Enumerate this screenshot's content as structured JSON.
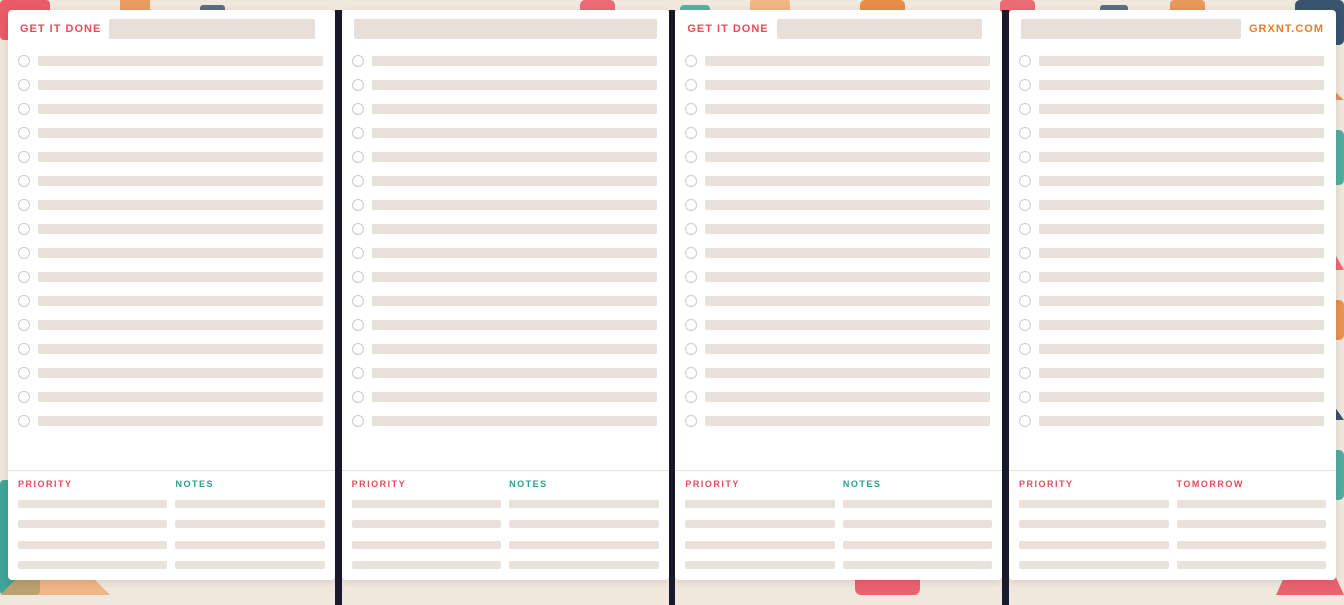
{
  "cards": [
    {
      "id": "card1",
      "brand_left": "GET IT DONE",
      "brand_right": "",
      "show_right": false,
      "bottom_sections": [
        {
          "label": "PRIORITY",
          "label_class": "priority"
        },
        {
          "label": "NOTES",
          "label_class": "notes"
        }
      ],
      "checklist_rows": 16
    },
    {
      "id": "card2",
      "brand_left": "",
      "brand_right": "",
      "show_right": false,
      "bottom_sections": [
        {
          "label": "PRIORITY",
          "label_class": "priority"
        },
        {
          "label": "NOTES",
          "label_class": "notes"
        }
      ],
      "checklist_rows": 16
    },
    {
      "id": "card3",
      "brand_left": "GET IT DONE",
      "brand_right": "",
      "show_right": false,
      "bottom_sections": [
        {
          "label": "PRIORITY",
          "label_class": "priority"
        },
        {
          "label": "NOTES",
          "label_class": "notes"
        }
      ],
      "checklist_rows": 16
    },
    {
      "id": "card4",
      "brand_left": "",
      "brand_right": "GRXNT.COM",
      "show_right": true,
      "bottom_sections": [
        {
          "label": "PRIORITY",
          "label_class": "priority"
        },
        {
          "label": "TOMORROW",
          "label_class": "tomorrow"
        }
      ],
      "checklist_rows": 16
    }
  ],
  "colors": {
    "brand_red": "#e84b5a",
    "brand_teal": "#2a9d8f",
    "brand_orange": "#e67d2e",
    "brand_navy": "#1a3a5c",
    "line_fill": "#e8e2db",
    "separator": "#1a1a2e"
  }
}
